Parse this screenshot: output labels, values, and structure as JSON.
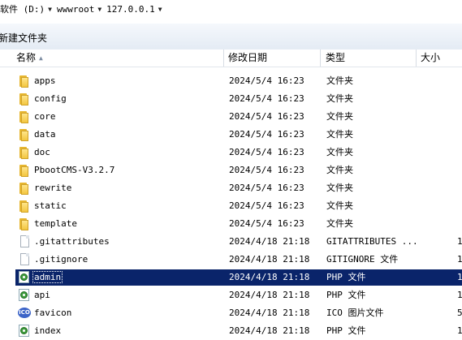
{
  "breadcrumb": {
    "items": [
      "软件 (D:)",
      "wwwroot",
      "127.0.0.1"
    ]
  },
  "toolbar": {
    "new_folder_label": "新建文件夹"
  },
  "columns": {
    "name": "名称",
    "date": "修改日期",
    "type": "类型",
    "size": "大小"
  },
  "files": [
    {
      "name": "apps",
      "date": "2024/5/4 16:23",
      "type": "文件夹",
      "size": "",
      "icon": "folder-icon"
    },
    {
      "name": "config",
      "date": "2024/5/4 16:23",
      "type": "文件夹",
      "size": "",
      "icon": "folder-icon"
    },
    {
      "name": "core",
      "date": "2024/5/4 16:23",
      "type": "文件夹",
      "size": "",
      "icon": "folder-icon"
    },
    {
      "name": "data",
      "date": "2024/5/4 16:23",
      "type": "文件夹",
      "size": "",
      "icon": "folder-icon"
    },
    {
      "name": "doc",
      "date": "2024/5/4 16:23",
      "type": "文件夹",
      "size": "",
      "icon": "folder-icon"
    },
    {
      "name": "PbootCMS-V3.2.7",
      "date": "2024/5/4 16:23",
      "type": "文件夹",
      "size": "",
      "icon": "folder-icon"
    },
    {
      "name": "rewrite",
      "date": "2024/5/4 16:23",
      "type": "文件夹",
      "size": "",
      "icon": "folder-icon"
    },
    {
      "name": "static",
      "date": "2024/5/4 16:23",
      "type": "文件夹",
      "size": "",
      "icon": "folder-icon"
    },
    {
      "name": "template",
      "date": "2024/5/4 16:23",
      "type": "文件夹",
      "size": "",
      "icon": "folder-icon"
    },
    {
      "name": ".gitattributes",
      "date": "2024/4/18 21:18",
      "type": "GITATTRIBUTES ...",
      "size": "1",
      "icon": "file-icon"
    },
    {
      "name": ".gitignore",
      "date": "2024/4/18 21:18",
      "type": "GITIGNORE 文件",
      "size": "1",
      "icon": "file-icon"
    },
    {
      "name": "admin",
      "date": "2024/4/18 21:18",
      "type": "PHP 文件",
      "size": "1",
      "icon": "php-file-icon",
      "selected": true
    },
    {
      "name": "api",
      "date": "2024/4/18 21:18",
      "type": "PHP 文件",
      "size": "1",
      "icon": "php-file-icon"
    },
    {
      "name": "favicon",
      "date": "2024/4/18 21:18",
      "type": "ICO 图片文件",
      "size": "5",
      "icon": "ico-file-icon"
    },
    {
      "name": "index",
      "date": "2024/4/18 21:18",
      "type": "PHP 文件",
      "size": "1",
      "icon": "php-file-icon"
    }
  ]
}
